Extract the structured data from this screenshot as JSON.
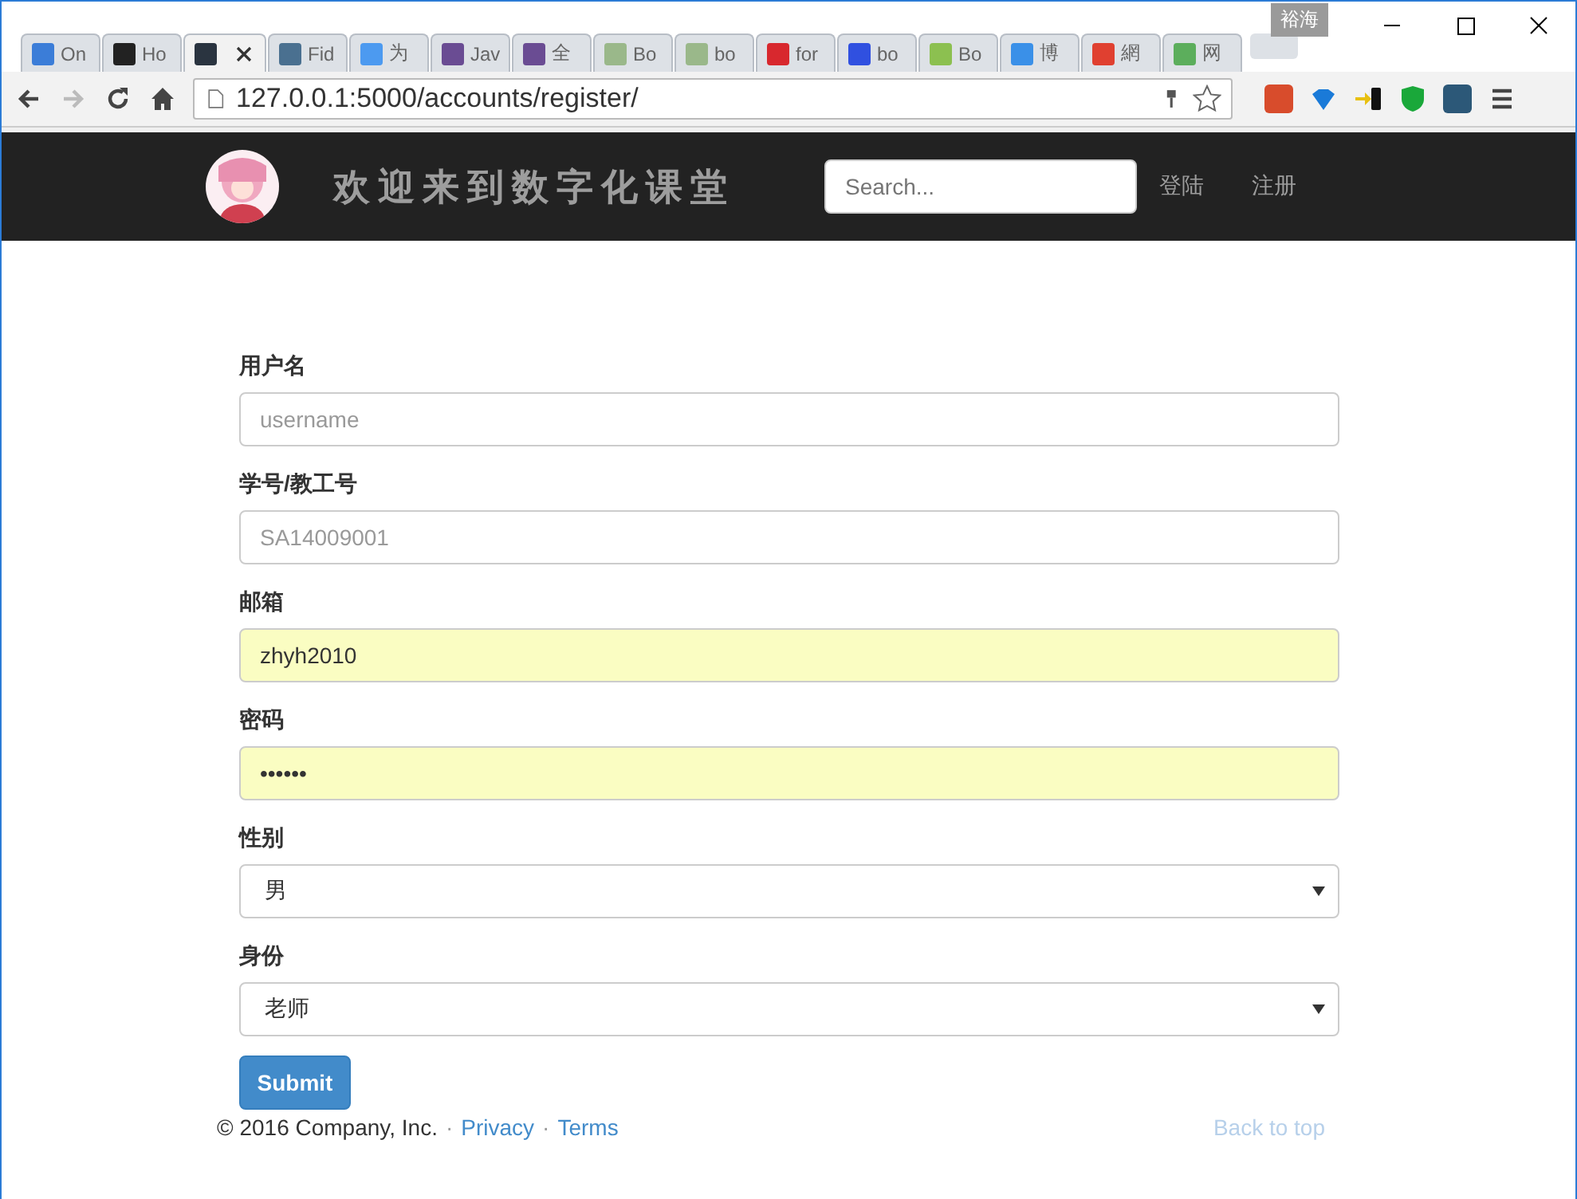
{
  "browser": {
    "profile": "裕海",
    "tabs": [
      {
        "title": "On",
        "color": "#3b7dd8",
        "selected": false
      },
      {
        "title": "Ho",
        "color": "#222222",
        "selected": false
      },
      {
        "color": "#2a3440",
        "selected": true
      },
      {
        "title": "Fid",
        "color": "#4a7090",
        "selected": false
      },
      {
        "title": "为",
        "color": "#4c9af0",
        "selected": false
      },
      {
        "title": "Jav",
        "color": "#6a4c93",
        "selected": false
      },
      {
        "title": "全",
        "color": "#6a4c93",
        "selected": false
      },
      {
        "title": "Bo",
        "color": "#9ab88a",
        "selected": false
      },
      {
        "title": "bo",
        "color": "#9ab88a",
        "selected": false
      },
      {
        "title": "for",
        "color": "#d8282e",
        "selected": false
      },
      {
        "title": "bo",
        "color": "#3050e0",
        "selected": false
      },
      {
        "title": "Bo",
        "color": "#8cc050",
        "selected": false
      },
      {
        "title": "博",
        "color": "#3a90e8",
        "selected": false
      },
      {
        "title": "網",
        "color": "#e04030",
        "selected": false
      },
      {
        "title": "网",
        "color": "#5cae5c",
        "selected": false
      }
    ],
    "url": "127.0.0.1:5000/accounts/register/"
  },
  "navbar": {
    "brand": "欢迎来到数字化课堂",
    "search": {
      "placeholder": "Search..."
    },
    "links": [
      "登陆",
      "注册"
    ]
  },
  "form": {
    "fields": [
      {
        "label": "用户名",
        "kind": "text",
        "placeholder": "username",
        "autofilled": false
      },
      {
        "label": "学号/教工号",
        "kind": "text",
        "placeholder": "SA14009001",
        "autofilled": false
      },
      {
        "label": "邮箱",
        "kind": "text",
        "value": "zhyh2010",
        "autofilled": true
      },
      {
        "label": "密码",
        "kind": "password",
        "value": "••••••",
        "autofilled": true
      },
      {
        "label": "性别",
        "kind": "select",
        "value": "男",
        "autofilled": false
      },
      {
        "label": "身份",
        "kind": "select",
        "value": "老师",
        "autofilled": false
      }
    ],
    "submit": "Submit"
  },
  "footer": {
    "copyright": "© 2016 Company, Inc.",
    "links": [
      {
        "separator": "·",
        "label": "Privacy"
      },
      {
        "separator": "·",
        "label": "Terms"
      }
    ],
    "back_to_top": "Back to top"
  }
}
